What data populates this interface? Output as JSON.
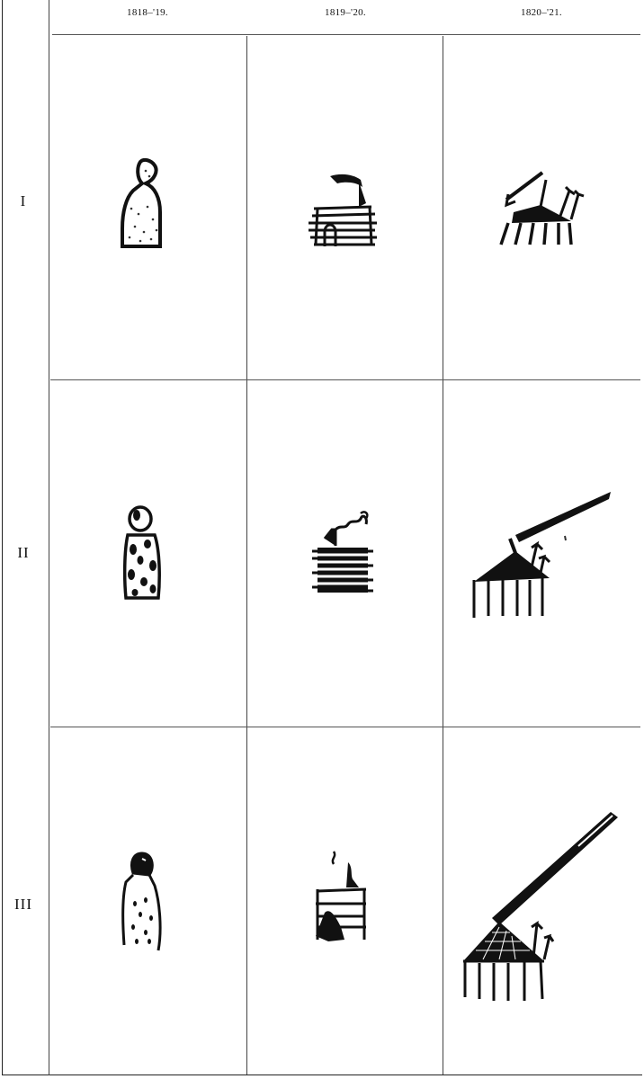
{
  "table": {
    "column_headers": [
      "1818–'19.",
      "1819–'20.",
      "1820–'21."
    ],
    "row_labels": [
      "I",
      "II",
      "III"
    ]
  },
  "glyphs": [
    [
      "person-figure-icon",
      "lodge-icon",
      "tipi-arrows-icon"
    ],
    [
      "spotted-person-figure-icon",
      "lodge-smoke-icon",
      "tipi-pole-arrows-icon"
    ],
    [
      "person-dots-figure-icon",
      "lodge-fire-icon",
      "tipi-spear-arrows-icon"
    ]
  ]
}
